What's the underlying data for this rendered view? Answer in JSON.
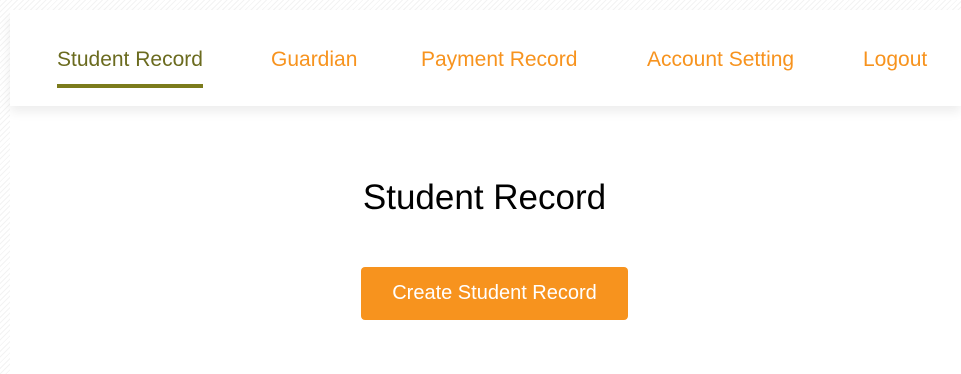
{
  "nav": {
    "items": [
      {
        "label": "Student Record",
        "active": true
      },
      {
        "label": "Guardian",
        "active": false
      },
      {
        "label": "Payment Record",
        "active": false
      },
      {
        "label": "Account Setting",
        "active": false
      },
      {
        "label": "Logout",
        "active": false
      }
    ]
  },
  "main": {
    "title": "Student Record",
    "create_button_label": "Create Student Record"
  },
  "colors": {
    "accent": "#f7931e",
    "active_text": "#6b6b1f",
    "active_underline": "#7b7b1c",
    "title_text": "#000000",
    "button_text": "#ffffff"
  }
}
